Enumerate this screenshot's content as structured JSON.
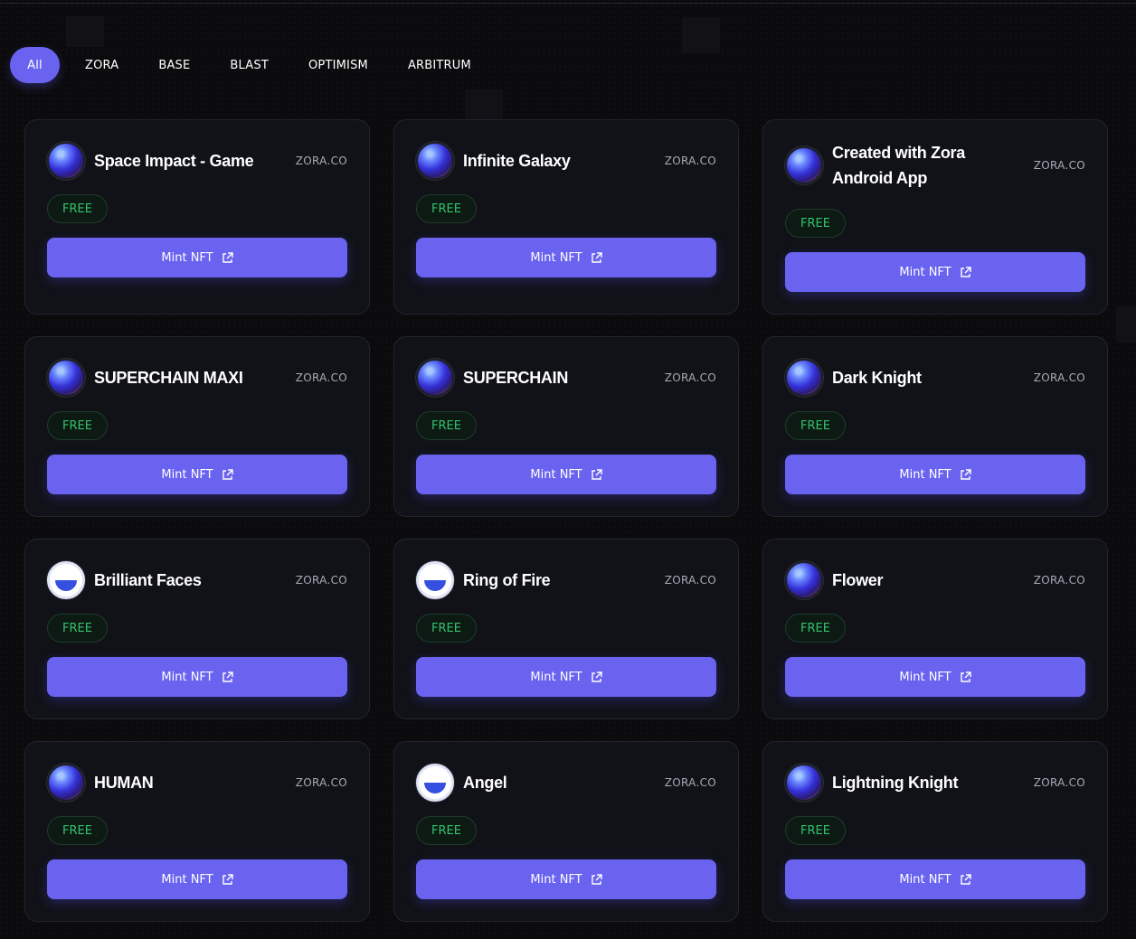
{
  "filters": [
    {
      "label": "All",
      "active": true
    },
    {
      "label": "ZORA",
      "active": false
    },
    {
      "label": "BASE",
      "active": false
    },
    {
      "label": "BLAST",
      "active": false
    },
    {
      "label": "OPTIMISM",
      "active": false
    },
    {
      "label": "ARBITRUM",
      "active": false
    }
  ],
  "colors": {
    "accent": "#6a63f0",
    "free_text": "#32c36a",
    "card_bg": "#101218",
    "page_bg": "#0b0b0d"
  },
  "cards": [
    {
      "title": "Space Impact - Game",
      "source": "ZORA.CO",
      "price": "FREE",
      "button": "Mint NFT",
      "avatar": "orb-icon"
    },
    {
      "title": "Infinite Galaxy",
      "source": "ZORA.CO",
      "price": "FREE",
      "button": "Mint NFT",
      "avatar": "orb-icon"
    },
    {
      "title": "Created with Zora Android App",
      "source": "ZORA.CO",
      "price": "FREE",
      "button": "Mint NFT",
      "avatar": "orb-icon"
    },
    {
      "title": "SUPERCHAIN MAXI",
      "source": "ZORA.CO",
      "price": "FREE",
      "button": "Mint NFT",
      "avatar": "orb-icon"
    },
    {
      "title": "SUPERCHAIN",
      "source": "ZORA.CO",
      "price": "FREE",
      "button": "Mint NFT",
      "avatar": "orb-icon"
    },
    {
      "title": "Dark Knight",
      "source": "ZORA.CO",
      "price": "FREE",
      "button": "Mint NFT",
      "avatar": "orb-icon"
    },
    {
      "title": "Brilliant Faces",
      "source": "ZORA.CO",
      "price": "FREE",
      "button": "Mint NFT",
      "avatar": "half-circle-icon"
    },
    {
      "title": "Ring of Fire",
      "source": "ZORA.CO",
      "price": "FREE",
      "button": "Mint NFT",
      "avatar": "half-circle-icon"
    },
    {
      "title": "Flower",
      "source": "ZORA.CO",
      "price": "FREE",
      "button": "Mint NFT",
      "avatar": "orb-icon"
    },
    {
      "title": "HUMAN",
      "source": "ZORA.CO",
      "price": "FREE",
      "button": "Mint NFT",
      "avatar": "orb-icon"
    },
    {
      "title": "Angel",
      "source": "ZORA.CO",
      "price": "FREE",
      "button": "Mint NFT",
      "avatar": "half-circle-icon"
    },
    {
      "title": "Lightning Knight",
      "source": "ZORA.CO",
      "price": "FREE",
      "button": "Mint NFT",
      "avatar": "orb-icon"
    }
  ]
}
